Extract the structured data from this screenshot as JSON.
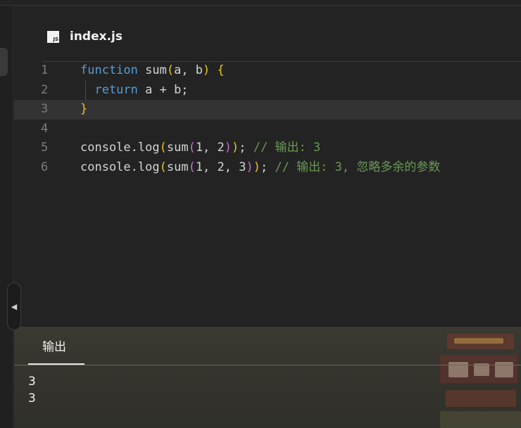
{
  "file": {
    "icon_label": "JS",
    "name": "index.js"
  },
  "editor": {
    "active_line": 3,
    "lines": [
      {
        "num": "1",
        "tokens": [
          {
            "t": "function",
            "c": "kw"
          },
          {
            "t": " sum",
            "c": "fn"
          },
          {
            "t": "(",
            "c": "p1"
          },
          {
            "t": "a, b",
            "c": "fn"
          },
          {
            "t": ")",
            "c": "p1"
          },
          {
            "t": " ",
            "c": "fn"
          },
          {
            "t": "{",
            "c": "p1"
          }
        ]
      },
      {
        "num": "2",
        "tokens": [
          {
            "t": "  return",
            "c": "kw"
          },
          {
            "t": " a + b;",
            "c": "fn"
          }
        ],
        "guide": true
      },
      {
        "num": "3",
        "tokens": [
          {
            "t": "}",
            "c": "p1"
          }
        ]
      },
      {
        "num": "4",
        "tokens": []
      },
      {
        "num": "5",
        "tokens": [
          {
            "t": "console.log",
            "c": "fn"
          },
          {
            "t": "(",
            "c": "p1"
          },
          {
            "t": "sum",
            "c": "fn"
          },
          {
            "t": "(",
            "c": "p2"
          },
          {
            "t": "1, 2",
            "c": "num"
          },
          {
            "t": ")",
            "c": "p2"
          },
          {
            "t": ")",
            "c": "p1"
          },
          {
            "t": "; ",
            "c": "fn"
          },
          {
            "t": "// 输出: 3",
            "c": "cm"
          }
        ]
      },
      {
        "num": "6",
        "tokens": [
          {
            "t": "console.log",
            "c": "fn"
          },
          {
            "t": "(",
            "c": "p1"
          },
          {
            "t": "sum",
            "c": "fn"
          },
          {
            "t": "(",
            "c": "p2"
          },
          {
            "t": "1, 2, 3",
            "c": "num"
          },
          {
            "t": ")",
            "c": "p2"
          },
          {
            "t": ")",
            "c": "p1"
          },
          {
            "t": "; ",
            "c": "fn"
          },
          {
            "t": "// 输出: 3, 忽略多余的参数",
            "c": "cm"
          }
        ]
      }
    ]
  },
  "output": {
    "tab_label": "输出",
    "lines": [
      "3",
      "3"
    ]
  },
  "icons": {
    "collapse": "triangle-left-icon",
    "file": "js-file-icon"
  },
  "colors": {
    "keyword": "#569cd6",
    "bracket1": "#e8c22a",
    "bracket2": "#c66fd0",
    "comment": "#6a9955"
  }
}
